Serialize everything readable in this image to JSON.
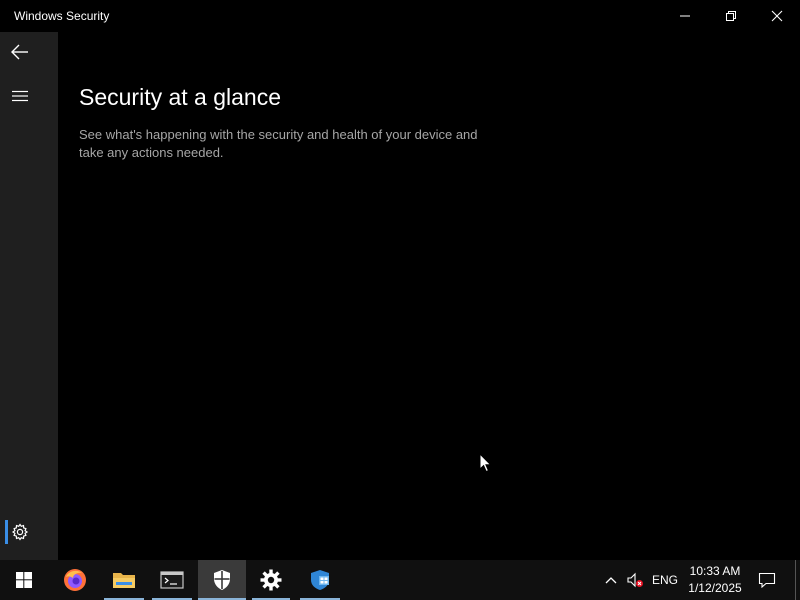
{
  "window": {
    "title": "Windows Security",
    "controls": {
      "minimize": "minimize-icon",
      "restore": "restore-icon",
      "close": "close-icon"
    }
  },
  "nav": {
    "back": "back-arrow-icon",
    "menu": "hamburger-menu-icon",
    "settings": "gear-icon"
  },
  "main": {
    "title": "Security at a glance",
    "description": "See what's happening with the security and health of your device and take any actions needed."
  },
  "taskbar": {
    "apps": [
      {
        "name": "start",
        "icon": "windows-logo-icon"
      },
      {
        "name": "firefox",
        "icon": "firefox-icon"
      },
      {
        "name": "file-explorer",
        "icon": "folder-icon"
      },
      {
        "name": "terminal",
        "icon": "terminal-icon"
      },
      {
        "name": "windows-security",
        "icon": "shield-icon",
        "active": true
      },
      {
        "name": "settings",
        "icon": "gear-icon"
      },
      {
        "name": "other-app",
        "icon": "app-blue-icon"
      }
    ],
    "tray": {
      "overflow": "chevron-up-icon",
      "volume": "volume-muted-icon",
      "language": "ENG",
      "time": "10:33 AM",
      "date": "1/12/2025",
      "notifications": "notification-icon"
    }
  },
  "colors": {
    "accent": "#3a8ee6",
    "rail": "#1f1f1f",
    "taskbar": "#101010",
    "description_text": "#a6a6a6"
  }
}
